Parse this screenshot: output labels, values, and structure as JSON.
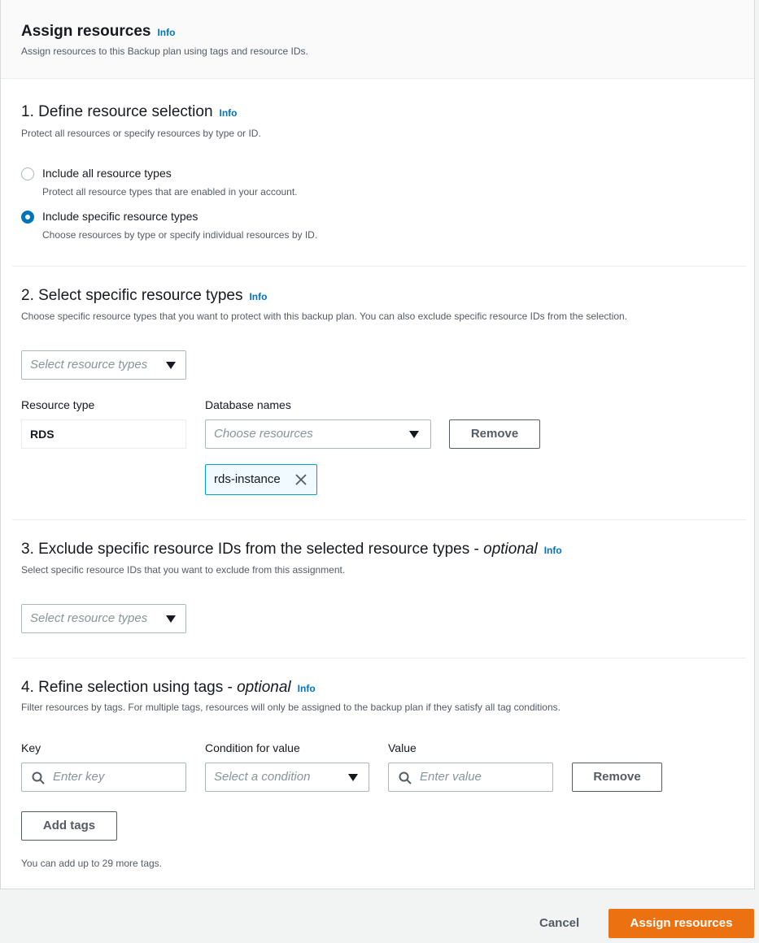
{
  "header": {
    "title": "Assign resources",
    "info": "Info",
    "description": "Assign resources to this Backup plan using tags and resource IDs."
  },
  "section1": {
    "title": "1. Define resource selection",
    "info": "Info",
    "description": "Protect all resources or specify resources by type or ID.",
    "options": [
      {
        "label": "Include all resource types",
        "description": "Protect all resource types that are enabled in your account.",
        "checked": false
      },
      {
        "label": "Include specific resource types",
        "description": "Choose resources by type or specify individual resources by ID.",
        "checked": true
      }
    ]
  },
  "section2": {
    "title": "2. Select specific resource types",
    "info": "Info",
    "description": "Choose specific resource types that you want to protect with this backup plan. You can also exclude specific resource IDs from the selection.",
    "select_placeholder": "Select resource types",
    "resource_type_label": "Resource type",
    "resource_type_value": "RDS",
    "database_names_label": "Database names",
    "database_names_placeholder": "Choose resources",
    "remove_label": "Remove",
    "tokens": [
      "rds-instance"
    ]
  },
  "section3": {
    "title_main": "3. Exclude specific resource IDs from the selected resource types - ",
    "title_optional": "optional",
    "info": "Info",
    "description": "Select specific resource IDs that you want to exclude from this assignment.",
    "select_placeholder": "Select resource types"
  },
  "section4": {
    "title_main": "4. Refine selection using tags - ",
    "title_optional": "optional",
    "info": "Info",
    "description": "Filter resources by tags. For multiple tags, resources will only be assigned to the backup plan if they satisfy all tag conditions.",
    "key_label": "Key",
    "key_placeholder": "Enter key",
    "condition_label": "Condition for value",
    "condition_placeholder": "Select a condition",
    "value_label": "Value",
    "value_placeholder": "Enter value",
    "remove_label": "Remove",
    "add_tags_label": "Add tags",
    "limit_note": "You can add up to 29 more tags."
  },
  "footer": {
    "cancel_label": "Cancel",
    "submit_label": "Assign resources"
  },
  "colors": {
    "accent": "#0073bb",
    "primary_button": "#ec7211",
    "token_border": "#00a1c9"
  }
}
